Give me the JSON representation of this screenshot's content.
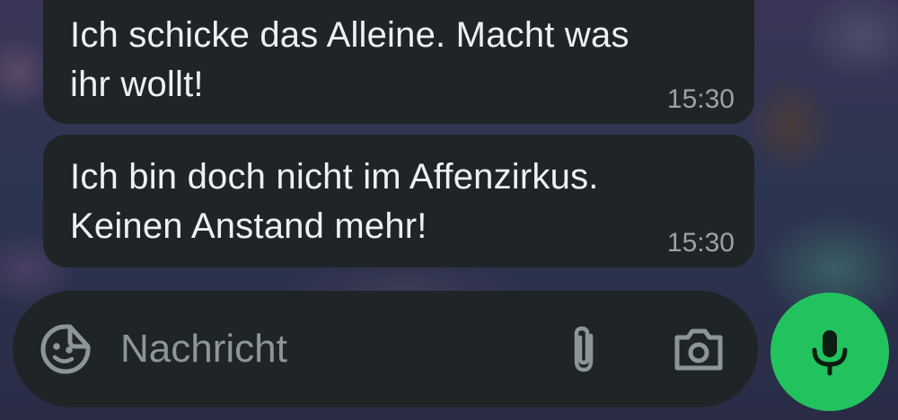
{
  "conversation": {
    "messages": [
      {
        "text_line1": "Ich schicke das Alleine. Macht was",
        "text_line2": "ihr wollt!",
        "time": "15:30"
      },
      {
        "text_line1": "Ich bin doch nicht im Affenzirkus.",
        "text_line2": "Keinen Anstand mehr!",
        "time": "15:30"
      }
    ]
  },
  "composer": {
    "placeholder": "Nachricht",
    "value": ""
  },
  "icons": {
    "emoji": "sticker-smiley-icon",
    "attach": "paperclip-icon",
    "camera": "camera-icon",
    "mic": "microphone-icon"
  },
  "colors": {
    "bubble_bg": "#1f2527",
    "text": "#eef1f1",
    "timestamp": "#9aa3a6",
    "icon": "#8c9699",
    "accent_green": "#22c35e"
  }
}
